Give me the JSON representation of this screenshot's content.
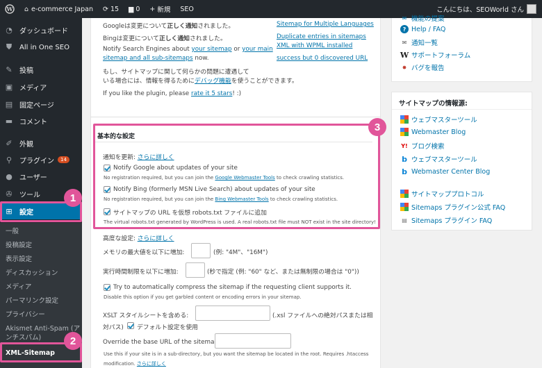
{
  "adminbar": {
    "site_name": "e-commerce Japan",
    "updates_count": "15",
    "comments_count": "0",
    "new_label": "新規",
    "seo_label": "SEO",
    "greeting": "こんにちは、SEOWorld さん"
  },
  "sidebar": {
    "items": [
      {
        "label": "ダッシュボード",
        "icon": "dashboard-icon"
      },
      {
        "label": "All in One SEO",
        "icon": "shield-icon"
      },
      {
        "label": "投稿",
        "icon": "pin-icon"
      },
      {
        "label": "メディア",
        "icon": "media-icon"
      },
      {
        "label": "固定ページ",
        "icon": "page-icon"
      },
      {
        "label": "コメント",
        "icon": "comment-icon"
      },
      {
        "label": "外観",
        "icon": "brush-icon"
      },
      {
        "label": "プラグイン",
        "icon": "plugin-icon",
        "badge": "14"
      },
      {
        "label": "ユーザー",
        "icon": "user-icon"
      },
      {
        "label": "ツール",
        "icon": "wrench-icon"
      },
      {
        "label": "設定",
        "icon": "settings-icon"
      }
    ],
    "sub_items": [
      "一般",
      "投稿設定",
      "表示設定",
      "ディスカッション",
      "メディア",
      "パーマリンク設定",
      "プライバシー",
      "Akismet Anti-Spam (ア",
      "ンチスパム)",
      "XML-Sitemap"
    ]
  },
  "main": {
    "intro": {
      "google_notice_pre": "Googleは変更について",
      "google_notice_bold": "正しく通知",
      "google_notice_post": "されました。",
      "bing_notice_pre": "Bingは変更について",
      "bing_notice_bold": "正しく通知",
      "bing_notice_post": "されました。",
      "notify_pre": "Notify Search Engines about ",
      "your_sitemap": "your sitemap",
      "or": " or ",
      "your_main_1": "your main",
      "your_main_2": "sitemap and all sub-sitemaps",
      "now": " now.",
      "problem_1": "もし、サイトマップに関して何らかの問題に遭遇して",
      "problem_2_pre": "いる場合には、情報を得るために",
      "debug_link": "デバッグ機能",
      "problem_2_post": "を使うことができます。",
      "like_pre": "If you like the plugin, please ",
      "rate_link": "rate it 5 stars",
      "like_post": "! :)",
      "right_links": [
        "Sitemap for Multiple Languages",
        "Duplicate entries in sitemaps",
        "XML with WPML installed",
        "success but 0 discovered URL"
      ]
    },
    "basic": {
      "title": "基本的な設定",
      "update_label": "通知を更新:",
      "more_link": "さらに詳しく",
      "google_label": "Notify Google about updates of your site",
      "google_desc_pre": "No registration required, but you can join the ",
      "google_desc_link": "Google Webmaster Tools",
      "google_desc_post": " to check crawling statistics.",
      "bing_label": "Notify Bing (formerly MSN Live Search) about updates of your site",
      "bing_desc_pre": "No registration required, but you can join the ",
      "bing_desc_link": "Bing Webmaster Tools",
      "bing_desc_post": " to check crawling statistics.",
      "robots_label": "サイトマップの URL を仮想 robots.txt ファイルに追加",
      "robots_desc": "The virtual robots.txt generated by WordPress is used. A real robots.txt file must NOT exist in the site directory!"
    },
    "advanced": {
      "label": "高度な設定:",
      "more_link": "さらに詳しく",
      "memory_label": "メモリの最大値を以下に増加:",
      "memory_hint": "(例: \"4M\"、\"16M\")",
      "time_label": "実行時間制限を以下に増加:",
      "time_hint": "(秒で指定 (例: \"60\" など、または無制限の場合は \"0\"))",
      "compress_label": "Try to automatically compress the sitemap if the requesting client supports it.",
      "compress_desc": "Disable this option if you get garbled content or encoding errors in your sitemap.",
      "xslt_label": "XSLT スタイルシートを含める:",
      "xslt_hint_1": "(.xsl ファイルへの絶対パスまたは相",
      "xslt_hint_2": "対パス)",
      "xslt_default": "デフォルト設定を使用",
      "override_label": "Override the base URL of the sitemap:",
      "override_desc_1": "Use this if your site is in a sub-directory, but you want the sitemap be located in the root. Requires .htaccess",
      "override_desc_2": "modification.",
      "override_more": "さらに詳しく"
    }
  },
  "right": {
    "top_links": [
      {
        "label": "機能の提案",
        "icon": "feature-icon"
      },
      {
        "label": "Help / FAQ",
        "icon": "help-icon"
      },
      {
        "label": "通知一覧",
        "icon": "email-icon"
      },
      {
        "label": "サポートフォーラム",
        "icon": "wordpress-icon"
      },
      {
        "label": "バグを報告",
        "icon": "bug-icon"
      }
    ],
    "info_box": {
      "title": "サイトマップの情報源:",
      "links": [
        {
          "label": "ウェブマスターツール",
          "icon": "google-icon"
        },
        {
          "label": "Webmaster Blog",
          "icon": "google-icon"
        },
        {
          "label": "ブログ検索",
          "icon": "yahoo-icon"
        },
        {
          "label": "ウェブマスターツール",
          "icon": "bing-icon"
        },
        {
          "label": "Webmaster Center Blog",
          "icon": "bing-icon"
        },
        {
          "label": "サイトマッププロトコル",
          "icon": "google-icon"
        },
        {
          "label": "Sitemaps プラグイン公式 FAQ",
          "icon": "google-icon"
        },
        {
          "label": "Sitemaps プラグイン FAQ",
          "icon": "page-icon"
        }
      ]
    }
  },
  "callouts": [
    "1",
    "2",
    "3"
  ],
  "colors": {
    "accent": "#0073aa",
    "highlight": "#e1559a",
    "adminbar": "#23282d"
  }
}
